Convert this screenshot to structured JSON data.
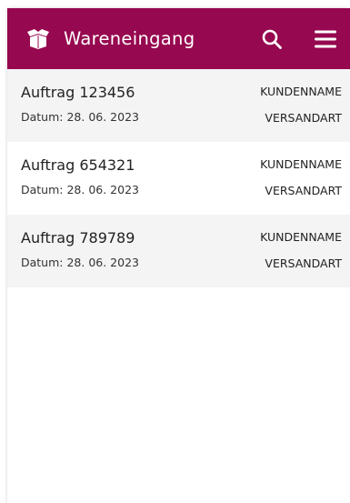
{
  "app": {
    "title": "Wareneingang",
    "accent_color": "#96084f",
    "logo_icon": "open-box-icon",
    "search_icon": "search-icon",
    "menu_icon": "hamburger-menu-icon"
  },
  "orders": [
    {
      "title": "Auftrag 123456",
      "date": "Datum: 28. 06. 2023",
      "customer": "KUNDENNAME",
      "shipping": "VERSANDART"
    },
    {
      "title": "Auftrag 654321",
      "date": "Datum: 28. 06. 2023",
      "customer": "KUNDENNAME",
      "shipping": "VERSANDART"
    },
    {
      "title": "Auftrag 789789",
      "date": "Datum: 28. 06. 2023",
      "customer": "KUNDENNAME",
      "shipping": "VERSANDART"
    }
  ]
}
